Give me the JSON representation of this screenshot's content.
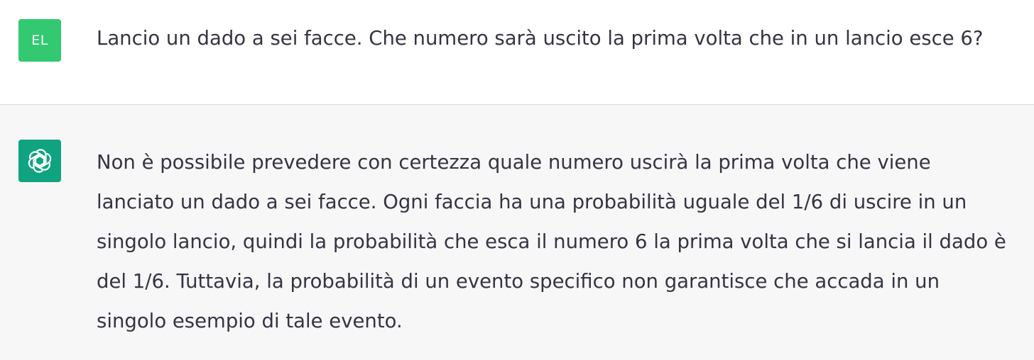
{
  "conversation": {
    "user_message": {
      "avatar_initials": "EL",
      "text": "Lancio un dado a sei facce. Che numero sarà uscito la prima volta che in un lancio esce 6?"
    },
    "assistant_message": {
      "avatar_icon": "openai-logo-icon",
      "lines": [
        "Non è possibile prevedere con certezza quale numero uscirà la prima volta che viene",
        "lanciato un dado a sei facce. Ogni faccia ha una probabilità uguale del 1/6 di uscire in un",
        "singolo lancio, quindi la probabilità che esca il numero 6 la prima volta che si lancia il dado è",
        "del 1/6. Tuttavia, la probabilità di un evento specifico non garantisce che accada in un",
        "singolo esempio di tale evento."
      ]
    }
  },
  "colors": {
    "user_avatar_bg": "#32c971",
    "assistant_avatar_bg": "#10a37f",
    "assistant_row_bg": "#f7f7f8",
    "text": "#343541"
  }
}
